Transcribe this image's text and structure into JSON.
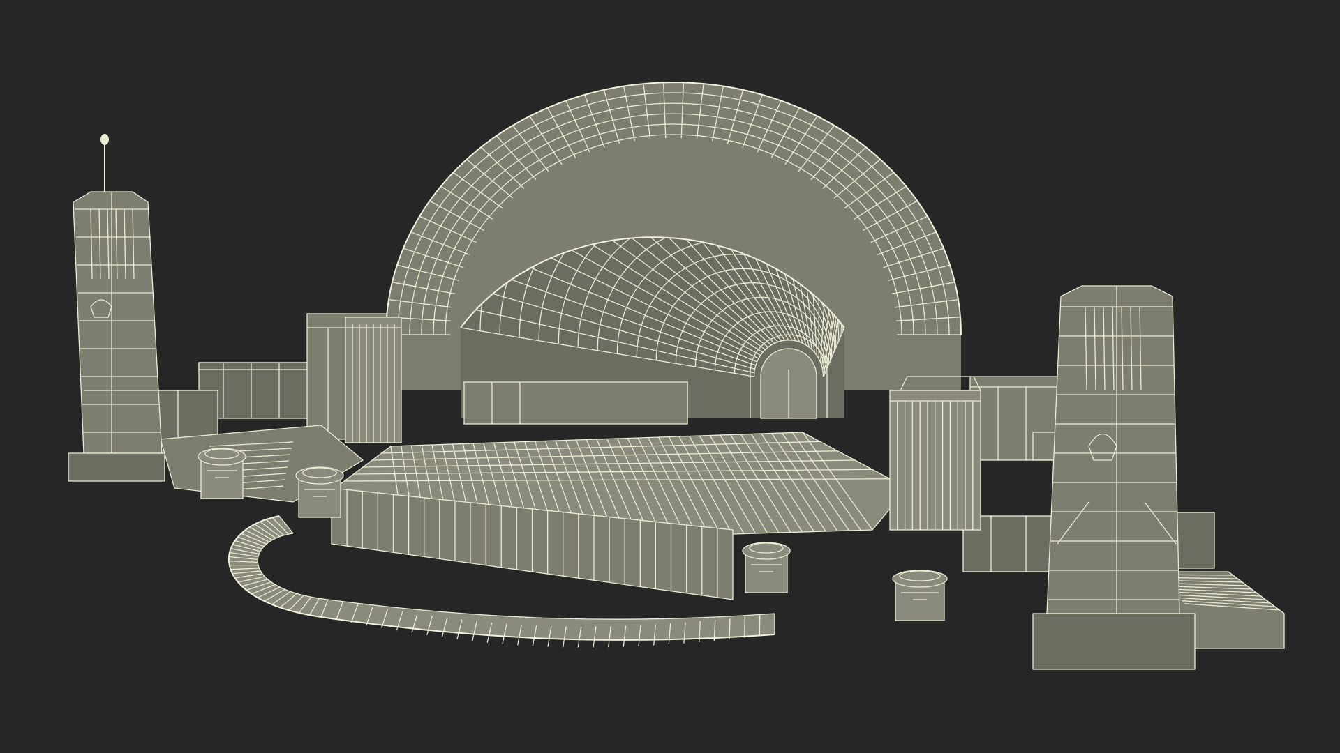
{
  "scene": {
    "background": "#262626",
    "surface_color": "#7d7e70",
    "wire_color": "#ecebd4",
    "subject": "art-deco-bandshell-wireframe"
  }
}
